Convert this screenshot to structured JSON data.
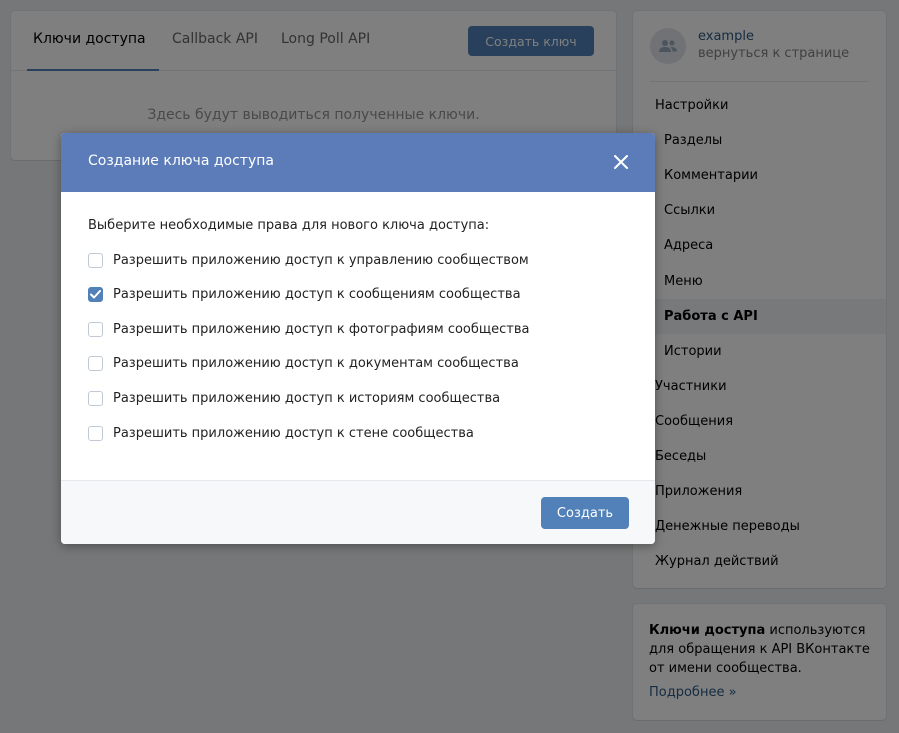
{
  "tabs": [
    {
      "label": "Ключи доступа",
      "active": true
    },
    {
      "label": "Callback API",
      "active": false
    },
    {
      "label": "Long Poll API",
      "active": false
    }
  ],
  "create_key_button": "Создать ключ",
  "empty_state": "Здесь будут выводиться полученные ключи.",
  "owner": {
    "name": "example",
    "back_link": "вернуться к странице",
    "avatar_icon": "community-icon"
  },
  "menu": [
    {
      "label": "Настройки",
      "level": 1
    },
    {
      "label": "Разделы",
      "level": 2
    },
    {
      "label": "Комментарии",
      "level": 2
    },
    {
      "label": "Ссылки",
      "level": 2
    },
    {
      "label": "Адреса",
      "level": 2
    },
    {
      "label": "Меню",
      "level": 2
    },
    {
      "label": "Работа с API",
      "level": 2,
      "selected": true
    },
    {
      "label": "Истории",
      "level": 2
    },
    {
      "label": "Участники",
      "level": 1
    },
    {
      "label": "Сообщения",
      "level": 1
    },
    {
      "label": "Беседы",
      "level": 1
    },
    {
      "label": "Приложения",
      "level": 1
    },
    {
      "label": "Денежные переводы",
      "level": 1
    },
    {
      "label": "Журнал действий",
      "level": 1
    }
  ],
  "info": {
    "bold": "Ключи доступа",
    "text": " используются для обращения к API ВКонтакте от имени сообщества.",
    "more": "Подробнее »"
  },
  "modal": {
    "title": "Создание ключа доступа",
    "close_icon": "close-icon",
    "prompt": "Выберите необходимые права для нового ключа доступа:",
    "permissions": [
      {
        "label": "Разрешить приложению доступ к управлению сообществом",
        "checked": false
      },
      {
        "label": "Разрешить приложению доступ к сообщениям сообщества",
        "checked": true
      },
      {
        "label": "Разрешить приложению доступ к фотографиям сообщества",
        "checked": false
      },
      {
        "label": "Разрешить приложению доступ к документам сообщества",
        "checked": false
      },
      {
        "label": "Разрешить приложению доступ к историям сообщества",
        "checked": false
      },
      {
        "label": "Разрешить приложению доступ к стене сообщества",
        "checked": false
      }
    ],
    "create_button": "Создать"
  },
  "colors": {
    "accent": "#5181b8",
    "modal_header": "#5b7cb9",
    "link": "#2a5885"
  }
}
